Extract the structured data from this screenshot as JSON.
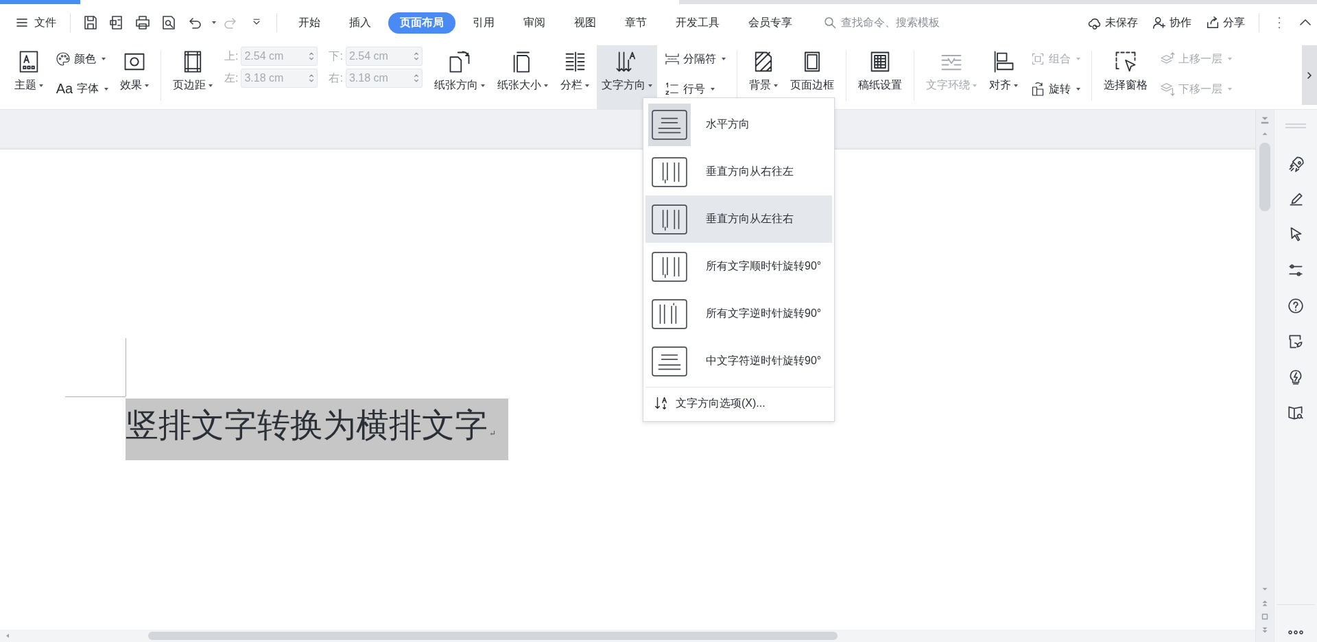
{
  "file_menu": {
    "label": "文件"
  },
  "tabs": [
    {
      "label": "开始",
      "selected": false
    },
    {
      "label": "插入",
      "selected": false
    },
    {
      "label": "页面布局",
      "selected": true
    },
    {
      "label": "引用",
      "selected": false
    },
    {
      "label": "审阅",
      "selected": false
    },
    {
      "label": "视图",
      "selected": false
    },
    {
      "label": "章节",
      "selected": false
    },
    {
      "label": "开发工具",
      "selected": false
    },
    {
      "label": "会员专享",
      "selected": false
    }
  ],
  "search": {
    "placeholder": "查找命令、搜索模板"
  },
  "header_actions": [
    {
      "label": "未保存"
    },
    {
      "label": "协作"
    },
    {
      "label": "分享"
    }
  ],
  "ribbon": [
    {
      "kind": "large",
      "label": "主题",
      "caret": true,
      "disabled": false,
      "pressed": false
    },
    {
      "kind": "stack",
      "items": [
        {
          "label": "颜色",
          "caret": true,
          "disabled": false
        },
        {
          "label": "字体",
          "caret": true,
          "disabled": false,
          "glyph": "Aa"
        }
      ]
    },
    {
      "kind": "large",
      "label": "效果",
      "caret": true,
      "disabled": false,
      "pressed": false
    },
    {
      "kind": "divider"
    },
    {
      "kind": "large",
      "label": "页边距",
      "caret": true,
      "disabled": false,
      "pressed": false
    },
    {
      "kind": "spin",
      "disabled": true,
      "items": [
        {
          "label": "上:",
          "value": "2.54 cm"
        },
        {
          "label": "左:",
          "value": "3.18 cm"
        }
      ]
    },
    {
      "kind": "spin",
      "disabled": true,
      "items": [
        {
          "label": "下:",
          "value": "2.54 cm"
        },
        {
          "label": "右:",
          "value": "3.18 cm"
        }
      ]
    },
    {
      "kind": "large",
      "label": "纸张方向",
      "caret": true,
      "disabled": false,
      "pressed": false
    },
    {
      "kind": "large",
      "label": "纸张大小",
      "caret": true,
      "disabled": false,
      "pressed": false
    },
    {
      "kind": "large",
      "label": "分栏",
      "caret": true,
      "disabled": false,
      "pressed": false
    },
    {
      "kind": "large",
      "label": "文字方向",
      "caret": true,
      "disabled": false,
      "pressed": true
    },
    {
      "kind": "stack",
      "items": [
        {
          "label": "分隔符",
          "caret": true,
          "disabled": false
        },
        {
          "label": "行号",
          "caret": true,
          "disabled": false
        }
      ]
    },
    {
      "kind": "divider"
    },
    {
      "kind": "large",
      "label": "背景",
      "caret": true,
      "disabled": false,
      "pressed": false
    },
    {
      "kind": "large",
      "label": "页面边框",
      "caret": false,
      "disabled": false,
      "pressed": false
    },
    {
      "kind": "divider"
    },
    {
      "kind": "large",
      "label": "稿纸设置",
      "caret": false,
      "disabled": false,
      "pressed": false
    },
    {
      "kind": "divider"
    },
    {
      "kind": "large",
      "label": "文字环绕",
      "caret": true,
      "disabled": true,
      "pressed": false
    },
    {
      "kind": "large",
      "label": "对齐",
      "caret": true,
      "disabled": false,
      "pressed": false
    },
    {
      "kind": "stack",
      "items": [
        {
          "label": "组合",
          "caret": true,
          "disabled": true
        },
        {
          "label": "旋转",
          "caret": true,
          "disabled": false
        }
      ]
    },
    {
      "kind": "divider"
    },
    {
      "kind": "large",
      "label": "选择窗格",
      "caret": false,
      "disabled": false,
      "pressed": false
    },
    {
      "kind": "stack",
      "items": [
        {
          "label": "上移一层",
          "caret": true,
          "disabled": true
        },
        {
          "label": "下移一层",
          "caret": true,
          "disabled": true
        }
      ]
    }
  ],
  "dropdown": {
    "items": [
      {
        "label": "水平方向",
        "current": true,
        "selected": false
      },
      {
        "label": "垂直方向从右往左",
        "current": false,
        "selected": false
      },
      {
        "label": "垂直方向从左往右",
        "current": false,
        "selected": true
      },
      {
        "label": "所有文字顺时针旋转90°",
        "current": false,
        "selected": false
      },
      {
        "label": "所有文字逆时针旋转90°",
        "current": false,
        "selected": false
      },
      {
        "label": "中文字符逆时针旋转90°",
        "current": false,
        "selected": false
      }
    ],
    "options": "文字方向选项(X)..."
  },
  "document": {
    "text": "竖排文字转换为横排文字",
    "selected": true,
    "paragraph_mark": "↵"
  }
}
